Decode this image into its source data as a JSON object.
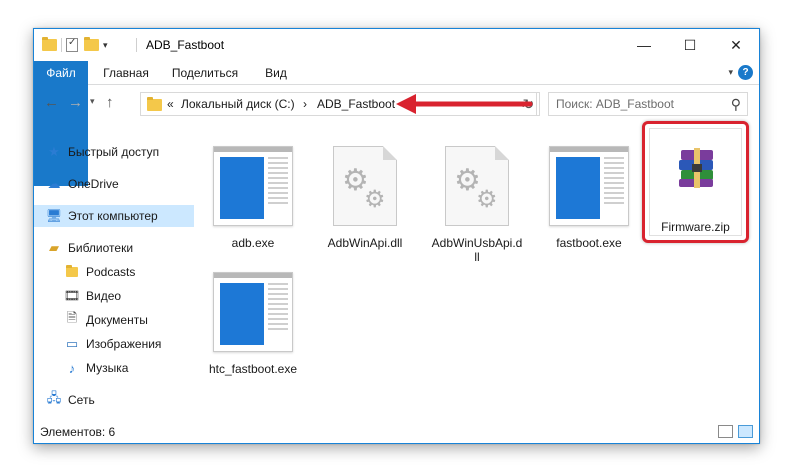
{
  "window": {
    "title": "ADB_Fastboot",
    "controls": {
      "minimize": "—",
      "maximize": "☐",
      "close": "✕"
    }
  },
  "ribbon": {
    "tabs": [
      "Файл",
      "Главная",
      "Поделиться",
      "Вид"
    ],
    "help": "?"
  },
  "navigation": {
    "breadcrumb_prefix": "«",
    "breadcrumb": [
      "Локальный диск (C:)",
      "ADB_Fastboot"
    ],
    "separator": "›",
    "search_placeholder": "Поиск: ADB_Fastboot"
  },
  "sidebar": {
    "items": [
      {
        "label": "Быстрый доступ",
        "icon": "star-icon"
      },
      {
        "label": "OneDrive",
        "icon": "cloud-icon"
      },
      {
        "label": "Этот компьютер",
        "icon": "computer-icon",
        "selected": true
      },
      {
        "label": "Библиотеки",
        "icon": "library-icon"
      },
      {
        "label": "Podcasts",
        "icon": "folder-icon"
      },
      {
        "label": "Видео",
        "icon": "video-icon"
      },
      {
        "label": "Документы",
        "icon": "document-icon"
      },
      {
        "label": "Изображения",
        "icon": "image-icon"
      },
      {
        "label": "Музыка",
        "icon": "music-icon"
      },
      {
        "label": "Сеть",
        "icon": "network-icon"
      }
    ]
  },
  "files": [
    {
      "name": "adb.exe",
      "type": "exe"
    },
    {
      "name": "AdbWinApi.dll",
      "type": "dll"
    },
    {
      "name": "AdbWinUsbApi.d\nll",
      "type": "dll"
    },
    {
      "name": "fastboot.exe",
      "type": "exe"
    },
    {
      "name": "Firmware.zip",
      "type": "zip",
      "highlighted": true
    },
    {
      "name": "htc_fastboot.exe",
      "type": "exe"
    }
  ],
  "status": {
    "item_count": "Элементов: 6"
  },
  "colors": {
    "accent": "#1979ca",
    "highlight": "#d9232f",
    "selection": "#cce8ff"
  }
}
